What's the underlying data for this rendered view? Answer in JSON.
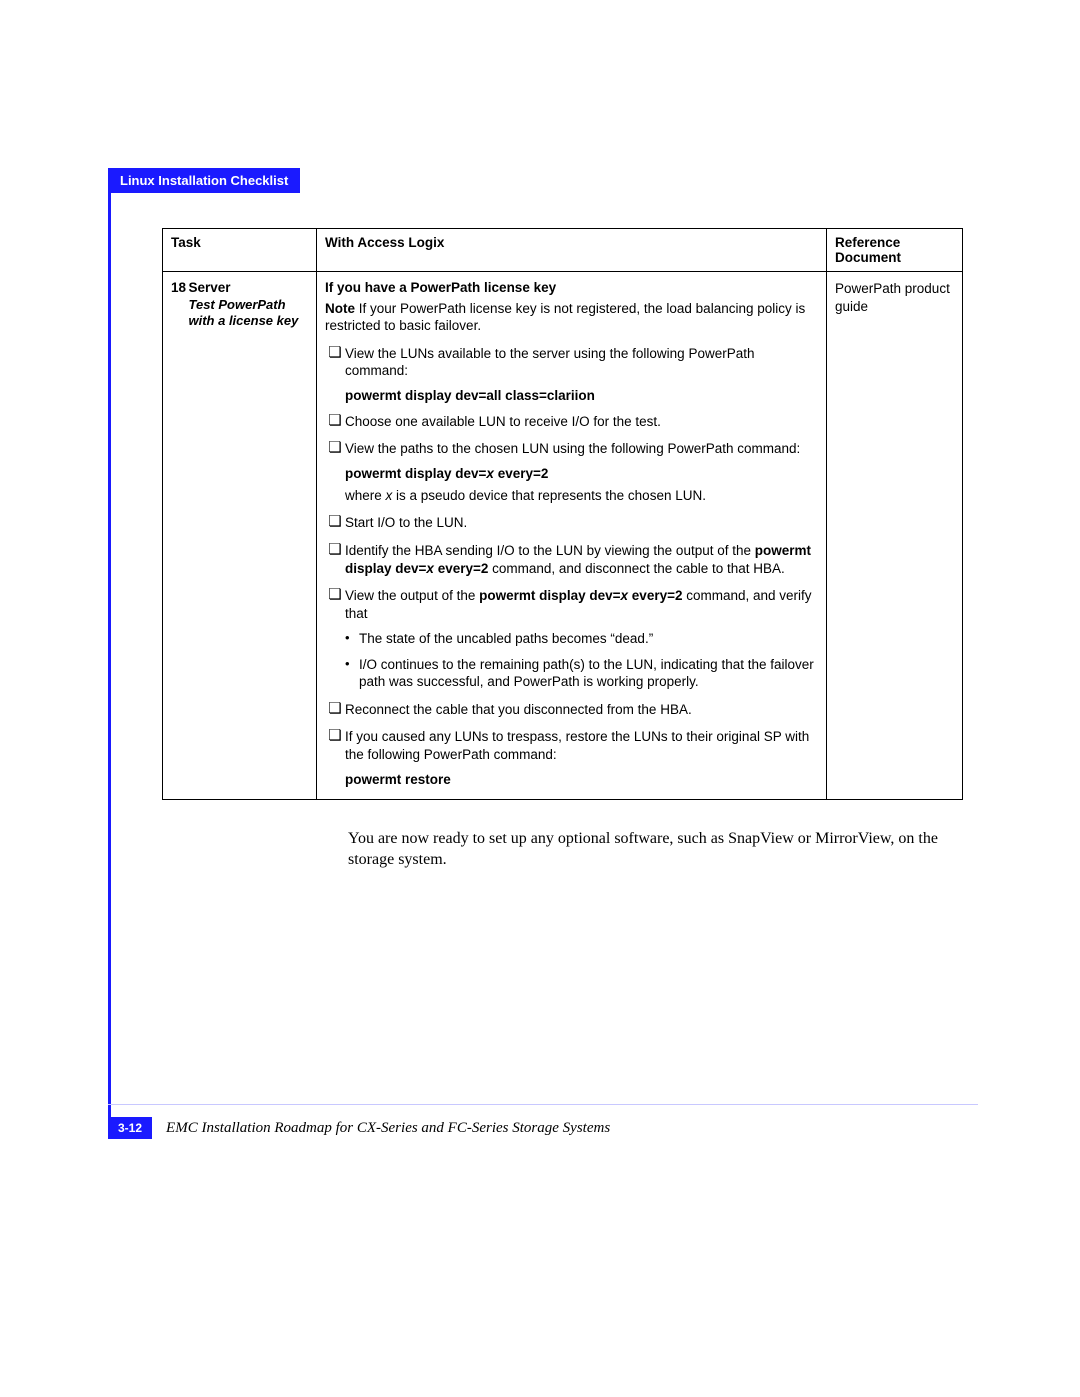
{
  "header": {
    "tab_label": "Linux Installation Checklist"
  },
  "table": {
    "headers": {
      "task": "Task",
      "main": "With Access Logix",
      "ref": "Reference Document"
    },
    "row": {
      "num": "18",
      "task_title": "Server",
      "task_sub1": "Test PowerPath",
      "task_sub2": "with a license key",
      "main_title": "If you have a PowerPath license key",
      "note_label": "Note",
      "note_text": " If your PowerPath license key is not registered, the load balancing policy is restricted to basic failover.",
      "c1": "View the LUNs available to the server using the following PowerPath command:",
      "cmd1": "powermt display dev=all class=clariion",
      "c2": "Choose one available LUN to receive I/O for the test.",
      "c3": "View the paths to the chosen LUN using the following PowerPath command:",
      "cmd2_pre": "powermt display dev=",
      "cmd2_x": "x",
      "cmd2_post": " every=2",
      "where_pre": "where ",
      "where_x": "x",
      "where_post": " is a pseudo device that represents the chosen LUN.",
      "c4": "Start I/O to the LUN.",
      "c5_pre": "Identify the HBA sending I/O to the LUN by viewing the output of the ",
      "c5_cmd_pre": "powermt display dev=",
      "c5_cmd_x": "x",
      "c5_cmd_post": " every=2",
      "c5_post": " command, and disconnect the cable to that HBA.",
      "c6_pre": "View the output of the ",
      "c6_cmd_pre": "powermt display dev=",
      "c6_cmd_x": "x",
      "c6_cmd_post": " every=2",
      "c6_post": " command, and verify that",
      "b1": "The state of the uncabled paths becomes “dead.”",
      "b2": "I/O continues to the remaining path(s) to the LUN, indicating that the failover path was successful, and PowerPath is working properly.",
      "c7": "Reconnect the cable that you disconnected from the HBA.",
      "c8": "If you caused any LUNs to trespass, restore the LUNs to their original SP with the following PowerPath command:",
      "cmd3": "powermt restore",
      "ref": "PowerPath product guide"
    }
  },
  "after_table": "You are now ready to set up any optional software, such as SnapView or MirrorView, on the storage system.",
  "footer": {
    "page_num": "3-12",
    "doc_title": "EMC Installation Roadmap for CX-Series and FC-Series Storage Systems"
  }
}
